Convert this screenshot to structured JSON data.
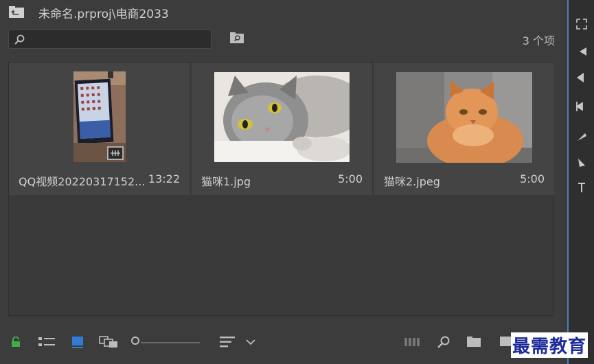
{
  "header": {
    "title": "未命名.prproj\\电商2033"
  },
  "search": {
    "placeholder": ""
  },
  "count": "3 个项",
  "items": [
    {
      "name": "QQ视频20220317152...",
      "duration": "13:22",
      "thumb": "video-screen-thumbnail"
    },
    {
      "name": "猫咪1.jpg",
      "duration": "5:00",
      "thumb": "gray-cat-thumbnail"
    },
    {
      "name": "猫咪2.jpeg",
      "duration": "5:00",
      "thumb": "orange-cat-thumbnail"
    }
  ],
  "toolbar": {
    "icons": [
      "lock-icon",
      "list-view-icon",
      "icon-view-icon",
      "freeform-view-icon",
      "zoom-slider",
      "sort-icon",
      "chevron-down-icon",
      "automate-sequence-icon",
      "find-icon",
      "new-bin-icon",
      "new-item-icon"
    ]
  },
  "watermark": "最需教育",
  "colors": {
    "accent": "#4a7fc1",
    "lock": "#3fae49",
    "panel": "#3c3c3c",
    "selected-view": "#2f7bd6"
  }
}
